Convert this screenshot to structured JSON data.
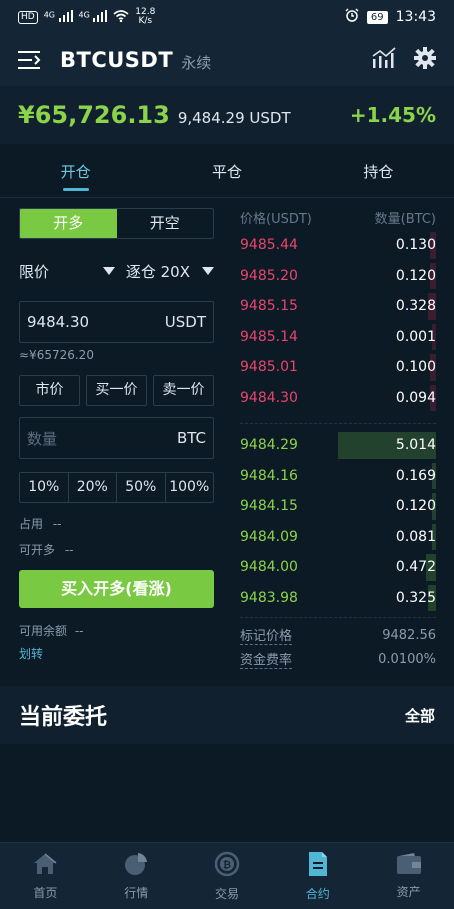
{
  "status_bar": {
    "hd": "HD",
    "signal1": "4G",
    "signal2": "4G",
    "speed": "12.8",
    "speed_unit": "K/s",
    "battery": "69",
    "time": "13:43"
  },
  "header": {
    "pair": "BTCUSDT",
    "subtitle": "永续"
  },
  "price_bar": {
    "price_cny": "¥65,726.13",
    "price_usdt": "9,484.29 USDT",
    "change": "+1.45%"
  },
  "tabs": [
    {
      "label": "开仓",
      "active": true
    },
    {
      "label": "平仓",
      "active": false
    },
    {
      "label": "持仓",
      "active": false
    }
  ],
  "trade": {
    "long_label": "开多",
    "short_label": "开空",
    "order_type": "限价",
    "margin_mode": "逐仓 20X",
    "price_value": "9484.30",
    "price_unit": "USDT",
    "approx": "≈¥65726.20",
    "quick_buttons": [
      "市价",
      "买一价",
      "卖一价"
    ],
    "qty_placeholder": "数量",
    "qty_unit": "BTC",
    "percents": [
      "10%",
      "20%",
      "50%",
      "100%"
    ],
    "used_label": "占用",
    "used_value": "--",
    "openable_label": "可开多",
    "openable_value": "--",
    "submit_label": "买入开多(看涨)",
    "available_label": "可用余额",
    "available_value": "--",
    "transfer_label": "划转"
  },
  "orderbook": {
    "price_header": "价格(USDT)",
    "qty_header": "数量(BTC)",
    "asks": [
      {
        "price": "9485.44",
        "qty": "0.130",
        "depth": 0.03
      },
      {
        "price": "9485.20",
        "qty": "0.120",
        "depth": 0.03
      },
      {
        "price": "9485.15",
        "qty": "0.328",
        "depth": 0.04
      },
      {
        "price": "9485.14",
        "qty": "0.001",
        "depth": 0.02
      },
      {
        "price": "9485.01",
        "qty": "0.100",
        "depth": 0.03
      },
      {
        "price": "9484.30",
        "qty": "0.094",
        "depth": 0.03
      }
    ],
    "bids": [
      {
        "price": "9484.29",
        "qty": "5.014",
        "depth": 0.5
      },
      {
        "price": "9484.16",
        "qty": "0.169",
        "depth": 0.02
      },
      {
        "price": "9484.15",
        "qty": "0.120",
        "depth": 0.02
      },
      {
        "price": "9484.09",
        "qty": "0.081",
        "depth": 0.02
      },
      {
        "price": "9484.00",
        "qty": "0.472",
        "depth": 0.05
      },
      {
        "price": "9483.98",
        "qty": "0.325",
        "depth": 0.04
      }
    ],
    "mark_label": "标记价格",
    "mark_value": "9482.56",
    "funding_label": "资金费率",
    "funding_value": "0.0100%"
  },
  "orders": {
    "title": "当前委托",
    "all_label": "全部"
  },
  "bottom_nav": [
    {
      "label": "首页",
      "icon": "home-icon",
      "active": false
    },
    {
      "label": "行情",
      "icon": "pie-chart-icon",
      "active": false
    },
    {
      "label": "交易",
      "icon": "bitcoin-exchange-icon",
      "active": false
    },
    {
      "label": "合约",
      "icon": "document-icon",
      "active": true
    },
    {
      "label": "资产",
      "icon": "wallet-icon",
      "active": false
    }
  ],
  "colors": {
    "accent": "#4fb6d4",
    "up": "#8bd34a",
    "down": "#e8456b",
    "background": "#0c1a26"
  }
}
